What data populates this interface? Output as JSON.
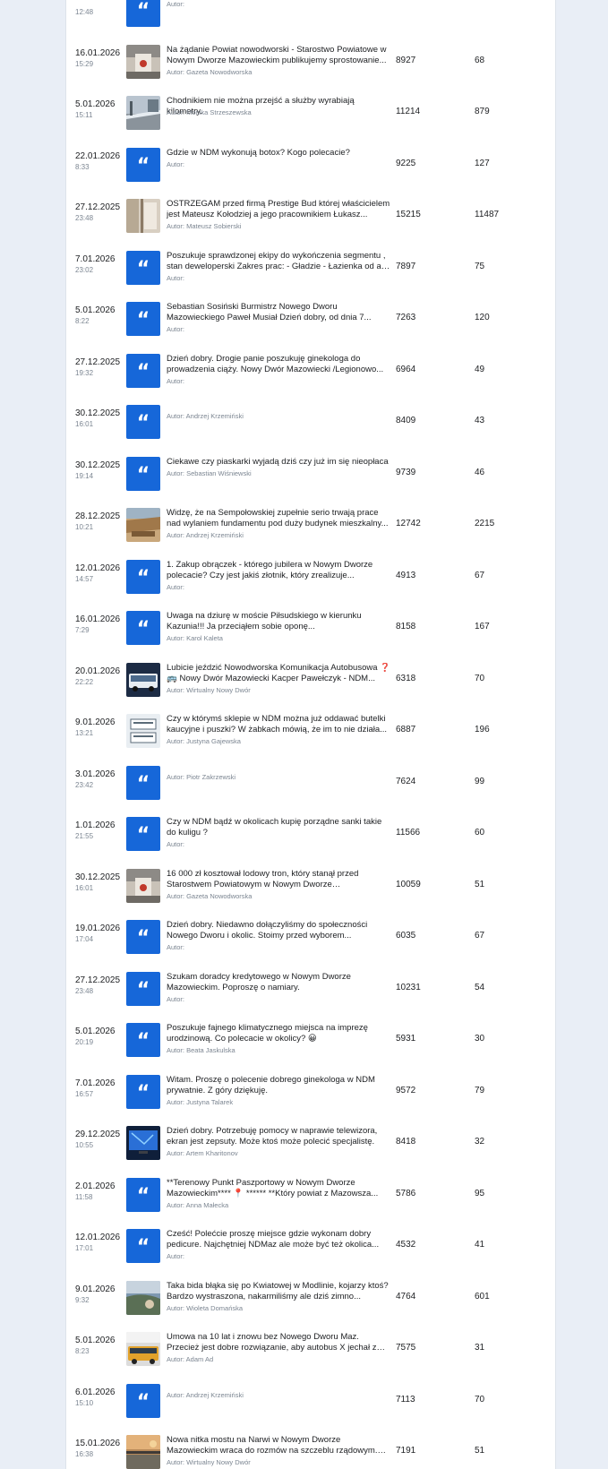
{
  "author_prefix": "Autor:",
  "rows": [
    {
      "date": "",
      "time": "12:48",
      "thumb": "quote",
      "title": "",
      "author": "Autor:",
      "views": "",
      "comments": ""
    },
    {
      "date": "16.01.2026",
      "time": "15:29",
      "thumb": "photo-sign",
      "title": "Na żądanie Powiat nowodworski - Starostwo Powiatowe w Nowym Dworze Mazowieckim publikujemy sprostowanie...",
      "author": "Autor: Gazeta Nowodworska",
      "views": "8927",
      "comments": "68"
    },
    {
      "date": "5.01.2026",
      "time": "15:11",
      "thumb": "photo-street",
      "title": "Chodnikiem nie można przejść a służby wyrabiają kilometry.",
      "author": "Autor: Monika Strzeszewska",
      "views": "11214",
      "comments": "879"
    },
    {
      "date": "22.01.2026",
      "time": "8:33",
      "thumb": "quote",
      "title": "Gdzie w NDM wykonują botox? Kogo polecacie?",
      "author": "Autor:",
      "views": "9225",
      "comments": "127"
    },
    {
      "date": "27.12.2025",
      "time": "23:48",
      "thumb": "photo-wall",
      "title": "OSTRZEGAM przed firmą Prestige Bud której właścicielem jest Mateusz Kołodziej a jego pracownikiem Łukasz...",
      "author": "Autor: Mateusz Sobierski",
      "views": "15215",
      "comments": "11487"
    },
    {
      "date": "7.01.2026",
      "time": "23:02",
      "thumb": "quote",
      "title": "Poszukuje sprawdzonej ekipy do wykończenia segmentu , stan deweloperski Zakres prac: - Gładzie - Łazienka od a d...",
      "author": "Autor:",
      "views": "7897",
      "comments": "75"
    },
    {
      "date": "5.01.2026",
      "time": "8:22",
      "thumb": "quote",
      "title": "Sebastian Sosiński Burmistrz Nowego Dworu Mazowieckiego Paweł Musiał Dzień dobry, od dnia 7...",
      "author": "Autor:",
      "views": "7263",
      "comments": "120"
    },
    {
      "date": "27.12.2025",
      "time": "19:32",
      "thumb": "quote",
      "title": "Dzień dobry. Drogie panie poszukuję ginekologa do prowadzenia ciąży. Nowy Dwór Mazowiecki /Legionowo...",
      "author": "Autor:",
      "views": "6964",
      "comments": "49"
    },
    {
      "date": "30.12.2025",
      "time": "16:01",
      "thumb": "quote",
      "title": "",
      "author": "Autor: Andrzej Krzemiński",
      "views": "8409",
      "comments": "43"
    },
    {
      "date": "30.12.2025",
      "time": "19:14",
      "thumb": "quote",
      "title": "Ciekawe czy piaskarki wyjadą dziś czy już im się nieopłaca",
      "author": "Autor: Sebastian Wiśniewski",
      "views": "9739",
      "comments": "46"
    },
    {
      "date": "28.12.2025",
      "time": "10:21",
      "thumb": "photo-site",
      "title": "Widzę, że na Sempołowskiej zupełnie serio trwają prace nad wylaniem fundamentu pod duży budynek mieszkalny...",
      "author": "Autor: Andrzej Krzemiński",
      "views": "12742",
      "comments": "2215"
    },
    {
      "date": "12.01.2026",
      "time": "14:57",
      "thumb": "quote",
      "title": "1. Zakup obrączek - którego jubilera w Nowym Dworze polecacie? Czy jest jakiś złotnik, który zrealizuje...",
      "author": "Autor:",
      "views": "4913",
      "comments": "67"
    },
    {
      "date": "16.01.2026",
      "time": "7:29",
      "thumb": "quote",
      "title": "Uwaga na dziurę w moście Piłsudskiego w kierunku Kazunia!!! Ja przeciąłem sobie oponę...",
      "author": "Autor: Karol Kaleta",
      "views": "8158",
      "comments": "167"
    },
    {
      "date": "20.01.2026",
      "time": "22:22",
      "thumb": "photo-bus",
      "title": "Lubicie jeździć Nowodworska Komunikacja Autobusowa ❓ 🚌 Nowy Dwór Mazowiecki Kacper Pawełczyk - NDM...",
      "author": "Autor: Wirtualny Nowy Dwór",
      "views": "6318",
      "comments": "70"
    },
    {
      "date": "9.01.2026",
      "time": "13:21",
      "thumb": "photo-bottle",
      "title": "Czy w którymś sklepie w NDM można już oddawać butelki kaucyjne i puszki? W żabkach mówią, że im to nie działa...",
      "author": "Autor: Justyna Gajewska",
      "views": "6887",
      "comments": "196"
    },
    {
      "date": "3.01.2026",
      "time": "23:42",
      "thumb": "quote",
      "title": "",
      "author": "Autor: Piotr Zakrzewski",
      "views": "7624",
      "comments": "99"
    },
    {
      "date": "1.01.2026",
      "time": "21:55",
      "thumb": "quote",
      "title": "Czy w NDM bądź w okolicach kupię porządne sanki takie do kuligu ?",
      "author": "Autor:",
      "views": "11566",
      "comments": "60"
    },
    {
      "date": "30.12.2025",
      "time": "16:01",
      "thumb": "photo-sign",
      "title": "16 000 zł kosztował lodowy tron, który stanął przed Starostwem Powiatowym w Nowym Dworze Mazowieckim...",
      "author": "Autor: Gazeta Nowodworska",
      "views": "10059",
      "comments": "51"
    },
    {
      "date": "19.01.2026",
      "time": "17:04",
      "thumb": "quote",
      "title": "Dzień dobry. Niedawno dołączyliśmy do społeczności Nowego Dworu i okolic. Stoimy przed wyborem...",
      "author": "Autor:",
      "views": "6035",
      "comments": "67"
    },
    {
      "date": "27.12.2025",
      "time": "23:48",
      "thumb": "quote",
      "title": "Szukam doradcy kredytowego w Nowym Dworze Mazowieckim. Poproszę o namiary.",
      "author": "Autor:",
      "views": "10231",
      "comments": "54"
    },
    {
      "date": "5.01.2026",
      "time": "20:19",
      "thumb": "quote",
      "title": "Poszukuje fajnego klimatycznego miejsca na imprezę urodzinową. Co polecacie w okolicy? 😀",
      "author": "Autor: Beata Jaskulska",
      "views": "5931",
      "comments": "30"
    },
    {
      "date": "7.01.2026",
      "time": "16:57",
      "thumb": "quote",
      "title": "Witam. Proszę o polecenie dobrego ginekologa w NDM prywatnie. Z góry dziękuję.",
      "author": "Autor: Justyna Talarek",
      "views": "9572",
      "comments": "79"
    },
    {
      "date": "29.12.2025",
      "time": "10:55",
      "thumb": "photo-tv",
      "title": "Dzień dobry. Potrzebuję pomocy w naprawie telewizora, ekran jest zepsuty. Może ktoś może polecić specjalistę.",
      "author": "Autor: Artem Kharitonov",
      "views": "8418",
      "comments": "32"
    },
    {
      "date": "2.01.2026",
      "time": "11:58",
      "thumb": "quote",
      "title": "**Terenowy Punkt Paszportowy w Nowym Dworze Mazowieckim**** 📍 ****** **Który powiat z Mazowsza...",
      "author": "Autor: Anna Małecka",
      "views": "5786",
      "comments": "95"
    },
    {
      "date": "12.01.2026",
      "time": "17:01",
      "thumb": "quote",
      "title": "Cześć! Polećcie proszę miejsce gdzie wykonam dobry pedicure. Najchętniej NDMaz ale może być też okolica...",
      "author": "Autor:",
      "views": "4532",
      "comments": "41"
    },
    {
      "date": "9.01.2026",
      "time": "9:32",
      "thumb": "photo-river",
      "title": "Taka bida błąka się po Kwiatowej w Modlinie, kojarzy ktoś? Bardzo wystraszona, nakarmiliśmy ale dziś zimno...",
      "author": "Autor: Wioleta Domańska",
      "views": "4764",
      "comments": "601"
    },
    {
      "date": "5.01.2026",
      "time": "8:23",
      "thumb": "photo-bus2",
      "title": "Umowa na 10 lat i znowu bez Nowego Dworu Maz. Przecież jest dobre rozwiązanie, aby autobus X jechał z Warszawy...",
      "author": "Autor: Adam Ad",
      "views": "7575",
      "comments": "31"
    },
    {
      "date": "6.01.2026",
      "time": "15:10",
      "thumb": "quote",
      "title": "",
      "author": "Autor: Andrzej Krzemiński",
      "views": "7113",
      "comments": "70"
    },
    {
      "date": "15.01.2026",
      "time": "16:38",
      "thumb": "photo-bridge",
      "title": "Nowa nitka mostu na Narwi w Nowym Dworze Mazowieckim wraca do rozmów na szczeblu rządowym. P...",
      "author": "Autor: Wirtualny Nowy Dwór",
      "views": "7191",
      "comments": "51"
    }
  ]
}
